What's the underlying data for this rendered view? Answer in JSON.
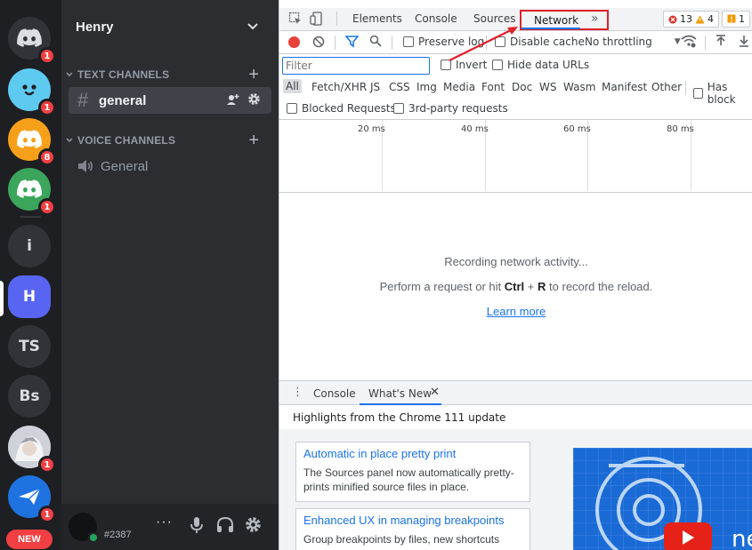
{
  "rail": {
    "servers": [
      {
        "name": "discord-home",
        "badge": "1",
        "color": "#36393f"
      },
      {
        "name": "server-blue-face",
        "badge": "1",
        "color": "#4fc3f7"
      },
      {
        "name": "server-orange",
        "badge": "8",
        "color": "#f6a01a"
      },
      {
        "name": "server-green",
        "badge": "1",
        "color": "#3ba55c"
      }
    ],
    "text_servers": [
      {
        "label": "i",
        "color": "#313338"
      },
      {
        "label": "H",
        "color": "#5865f2"
      },
      {
        "label": "TS",
        "color": "#313338"
      },
      {
        "label": "Bs",
        "color": "#313338"
      }
    ],
    "bottom_badges": [
      "1",
      "1"
    ],
    "new_label": "NEW"
  },
  "sidebar": {
    "guild_name": "Henry",
    "text_category": "TEXT CHANNELS",
    "text_channel": "general",
    "voice_category": "VOICE CHANNELS",
    "voice_channel": "General",
    "user_tag": "#2387"
  },
  "devtools": {
    "tabs": [
      "Elements",
      "Console",
      "Sources"
    ],
    "active_tab": "Network",
    "errors": "13",
    "warnings": "4",
    "issues": "1",
    "toolbar": {
      "preserve_log": "Preserve log",
      "disable_cache": "Disable cache",
      "throttling": "No throttling"
    },
    "filter": {
      "placeholder": "Filter",
      "invert": "Invert",
      "hide_data_urls": "Hide data URLs"
    },
    "types": [
      "All",
      "Fetch/XHR",
      "JS",
      "CSS",
      "Img",
      "Media",
      "Font",
      "Doc",
      "WS",
      "Wasm",
      "Manifest",
      "Other"
    ],
    "has_blocked": "Has block",
    "blocked_requests": "Blocked Requests",
    "third_party": "3rd-party requests",
    "ticks": [
      "20 ms",
      "40 ms",
      "60 ms",
      "80 ms"
    ],
    "empty": {
      "line1": "Recording network activity...",
      "line2_pre": "Perform a request or hit",
      "line2_key1": "Ctrl",
      "line2_plus": "+",
      "line2_key2": "R",
      "line2_post": "to record the reload.",
      "learn_more": "Learn more"
    },
    "drawer": {
      "tab1": "Console",
      "tab2": "What's New",
      "highlights": "Highlights from the Chrome 111 update",
      "cards": [
        {
          "title": "Automatic in place pretty print",
          "text": "The Sources panel now automatically pretty-prints minified source files in place."
        },
        {
          "title": "Enhanced UX in managing breakpoints",
          "text": "Group breakpoints by files, new shortcuts"
        }
      ],
      "promo_text": "ne"
    }
  }
}
